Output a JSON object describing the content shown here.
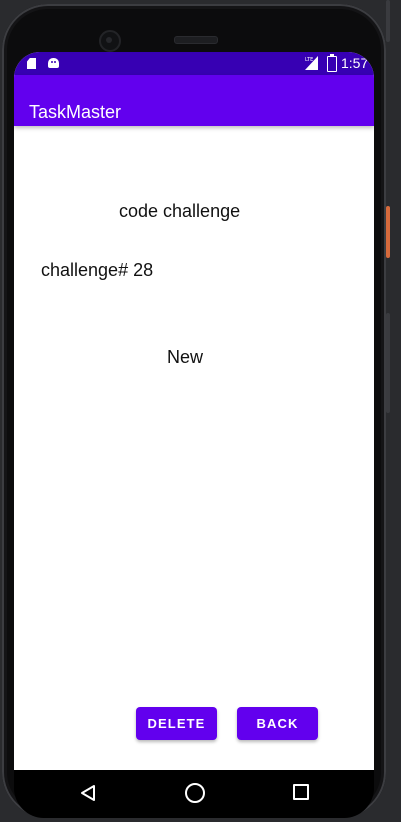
{
  "status_bar": {
    "time": "1:57",
    "icons": [
      "sd-card-icon",
      "android-icon",
      "lte-signal-icon",
      "battery-icon"
    ],
    "color": "#3700b3"
  },
  "app_bar": {
    "title": "TaskMaster",
    "color": "#6200ee"
  },
  "task": {
    "title": "code challenge",
    "body": "challenge# 28",
    "state": "New"
  },
  "actions": {
    "delete_label": "DELETE",
    "back_label": "BACK",
    "button_color": "#6200ee"
  },
  "navigation": {
    "icons": [
      "back-triangle-icon",
      "home-circle-icon",
      "recents-square-icon"
    ]
  }
}
